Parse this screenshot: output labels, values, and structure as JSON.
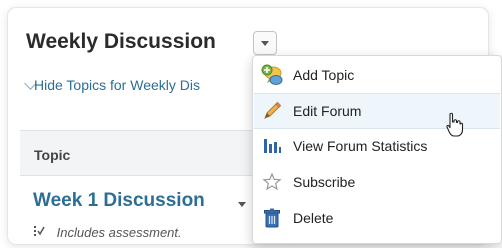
{
  "forum": {
    "title": "Weekly Discussion",
    "hide_topics_label": "Hide Topics for Weekly Dis"
  },
  "table": {
    "header": "Topic"
  },
  "topic": {
    "title": "Week 1 Discussion",
    "assessment_note": "Includes assessment."
  },
  "menu": {
    "items": [
      {
        "label": "Add Topic",
        "icon": "add-topic-icon"
      },
      {
        "label": "Edit Forum",
        "icon": "pencil-icon"
      },
      {
        "label": "View Forum Statistics",
        "icon": "statistics-icon"
      },
      {
        "label": "Subscribe",
        "icon": "star-icon"
      },
      {
        "label": "Delete",
        "icon": "trash-icon"
      }
    ],
    "hovered_index": 1
  },
  "colors": {
    "link": "#2d6f94",
    "menu_hover": "#eef6fb"
  }
}
